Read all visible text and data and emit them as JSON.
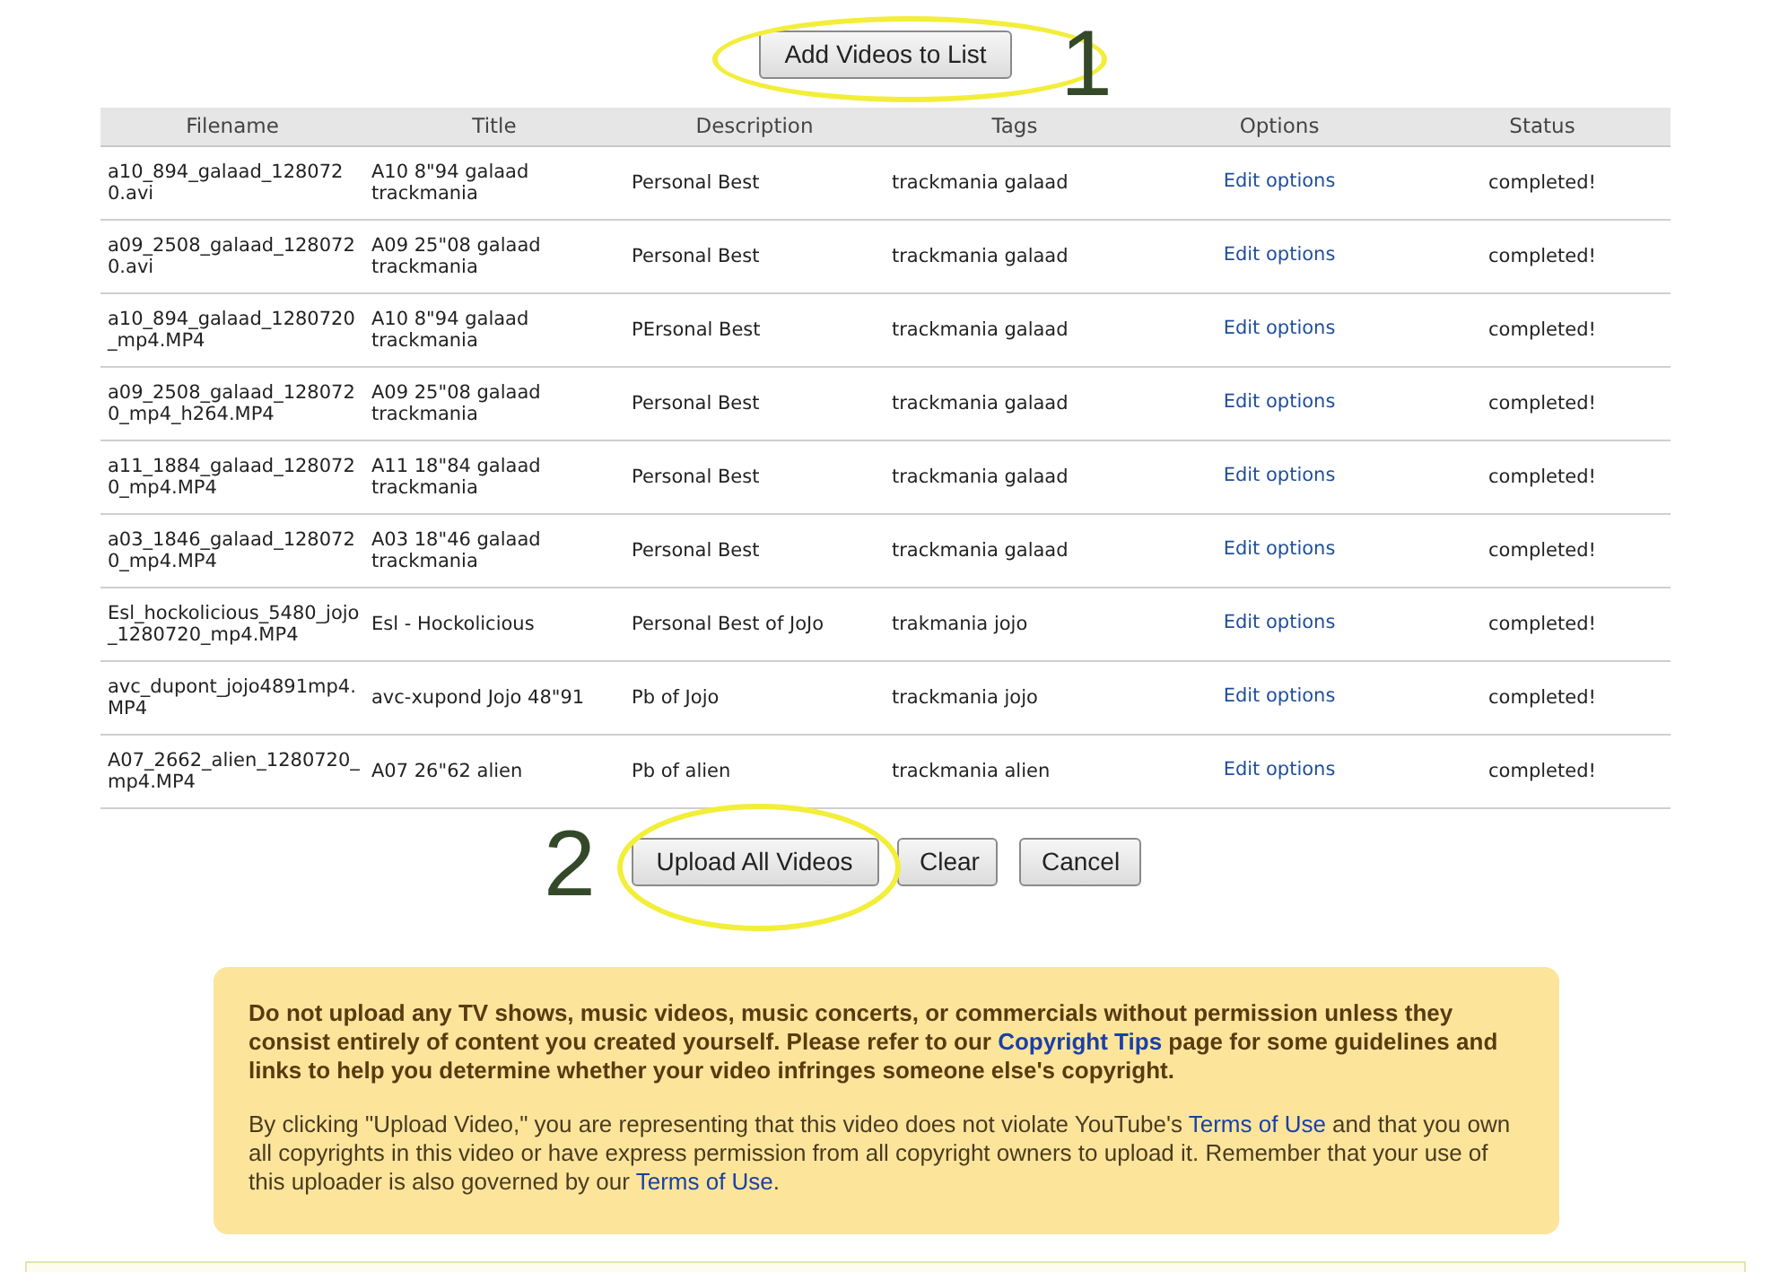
{
  "add_button": "Add Videos to List",
  "annotations": [
    {
      "number": "1"
    },
    {
      "number": "2"
    }
  ],
  "table": {
    "columns": [
      "Filename",
      "Title",
      "Description",
      "Tags",
      "Options",
      "Status"
    ],
    "rows": [
      {
        "filename": "a10_894_galaad_1280720.avi",
        "title": "A10 8\"94 galaad trackmania",
        "description": "Personal Best",
        "tags": "trackmania galaad",
        "options": "Edit options",
        "status": "completed!"
      },
      {
        "filename": "a09_2508_galaad_1280720.avi",
        "title": "A09 25\"08 galaad trackmania",
        "description": "Personal Best",
        "tags": "trackmania galaad",
        "options": "Edit options",
        "status": "completed!"
      },
      {
        "filename": "a10_894_galaad_1280720_mp4.MP4",
        "title": "A10 8\"94 galaad trackmania",
        "description": "PErsonal Best",
        "tags": "trackmania galaad",
        "options": "Edit options",
        "status": "completed!"
      },
      {
        "filename": "a09_2508_galaad_1280720_mp4_h264.MP4",
        "title": "A09 25\"08 galaad trackmania",
        "description": "Personal Best",
        "tags": "trackmania galaad",
        "options": "Edit options",
        "status": "completed!"
      },
      {
        "filename": "a11_1884_galaad_1280720_mp4.MP4",
        "title": "A11 18\"84 galaad trackmania",
        "description": "Personal Best",
        "tags": "trackmania galaad",
        "options": "Edit options",
        "status": "completed!"
      },
      {
        "filename": "a03_1846_galaad_1280720_mp4.MP4",
        "title": "A03 18\"46 galaad trackmania",
        "description": "Personal Best",
        "tags": "trackmania galaad",
        "options": "Edit options",
        "status": "completed!"
      },
      {
        "filename": "Esl_hockolicious_5480_jojo_1280720_mp4.MP4",
        "title": "Esl - Hockolicious",
        "description": "Personal Best of JoJo",
        "tags": "trakmania jojo",
        "options": "Edit options",
        "status": "completed!"
      },
      {
        "filename": "avc_dupont_jojo4891mp4.MP4",
        "title": "avc-xupond Jojo 48\"91",
        "description": "Pb of Jojo",
        "tags": "trackmania jojo",
        "options": "Edit options",
        "status": "completed!"
      },
      {
        "filename": "A07_2662_alien_1280720_mp4.MP4",
        "title": "A07 26\"62 alien",
        "description": "Pb of alien",
        "tags": "trackmania alien",
        "options": "Edit options",
        "status": "completed!"
      }
    ]
  },
  "buttons": [
    "Upload All Videos",
    "Clear",
    "Cancel"
  ],
  "notice": {
    "paragraphs": [
      {
        "bold": true,
        "parts": [
          {
            "kind": "text",
            "text": "Do not upload any TV shows, music videos, music concerts, or commercials without permission unless they consist entirely of content you created yourself. Please refer to our "
          },
          {
            "kind": "link",
            "text": "Copyright Tips"
          },
          {
            "kind": "text",
            "text": " page for some guidelines and links to help you determine whether your video infringes someone else's copyright."
          }
        ]
      },
      {
        "bold": false,
        "parts": [
          {
            "kind": "text",
            "text": "By clicking \"Upload Video,\" you are representing that this video does not violate YouTube's "
          },
          {
            "kind": "link",
            "text": "Terms of Use"
          },
          {
            "kind": "text",
            "text": " and that you own all copyrights in this video or have express permission from all copyright owners to upload it. Remember that your use of this uploader is also governed by our "
          },
          {
            "kind": "link",
            "text": "Terms of Use"
          },
          {
            "kind": "text",
            "text": "."
          }
        ]
      }
    ]
  }
}
